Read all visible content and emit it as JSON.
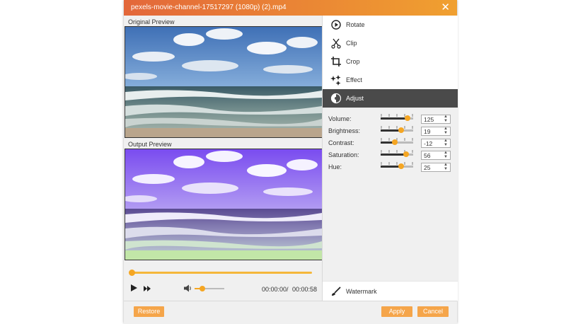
{
  "window": {
    "title": "pexels-movie-channel-17517297 (1080p) (2).mp4",
    "close_icon": "close-icon"
  },
  "preview": {
    "original_label": "Original Preview",
    "output_label": "Output Preview"
  },
  "playback": {
    "progress": 0.0,
    "current_time": "00:00:00",
    "separator": "/",
    "total_time": "00:00:58",
    "volume_level": 0.25
  },
  "tools": [
    {
      "label": "Rotate",
      "icon": "rotate-icon"
    },
    {
      "label": "Clip",
      "icon": "scissors-icon"
    },
    {
      "label": "Crop",
      "icon": "crop-icon"
    },
    {
      "label": "Effect",
      "icon": "sparkle-icon"
    },
    {
      "label": "Adjust",
      "icon": "adjust-icon",
      "active": true
    }
  ],
  "adjust": [
    {
      "label": "Volume:",
      "value": "125",
      "level": 0.83
    },
    {
      "label": "Brightness:",
      "value": "19",
      "level": 0.62
    },
    {
      "label": "Contrast:",
      "value": "-12",
      "level": 0.44
    },
    {
      "label": "Saturation:",
      "value": "56",
      "level": 0.78
    },
    {
      "label": "Hue:",
      "value": "25",
      "level": 0.62
    }
  ],
  "watermark": {
    "label": "Watermark",
    "icon": "brush-icon"
  },
  "footer": {
    "restore_label": "Restore",
    "apply_label": "Apply",
    "cancel_label": "Cancel"
  },
  "colors": {
    "accent": "#f5a623",
    "title_start": "#e3673a",
    "title_end": "#f0a030",
    "active_tool": "#4a4a4a"
  }
}
